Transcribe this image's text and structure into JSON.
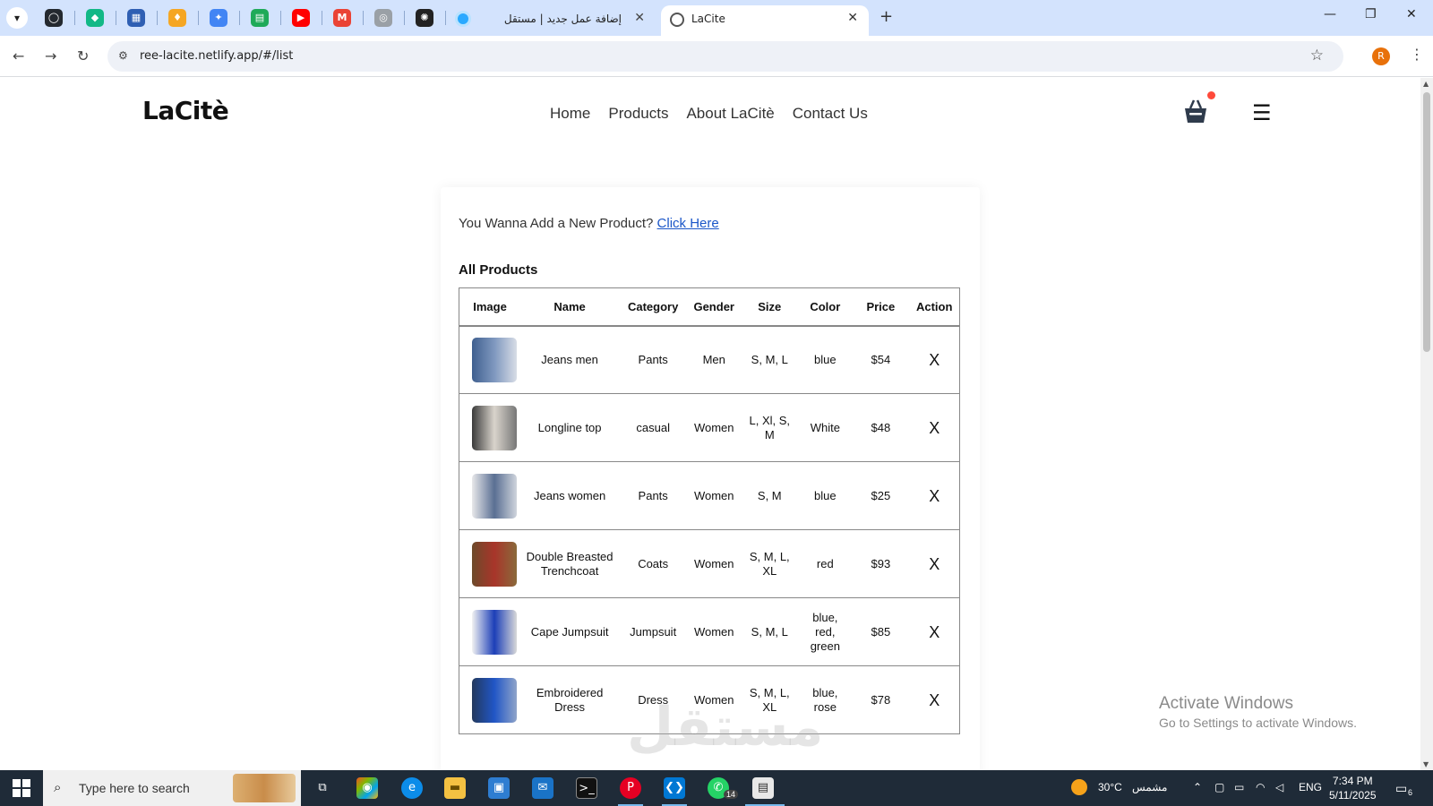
{
  "browser": {
    "pinned_tabs": [
      {
        "icon": "github-icon",
        "color": "#24292f",
        "glyph": "◯"
      },
      {
        "icon": "diamond-app-icon",
        "color": "#12b886",
        "glyph": "◆"
      },
      {
        "icon": "dashboard-app-icon",
        "color": "#2f5fb3",
        "glyph": "▦"
      },
      {
        "icon": "flame-app-icon",
        "color": "#f5a623",
        "glyph": "♦"
      },
      {
        "icon": "sparkle-app-icon",
        "color": "#4285f4",
        "glyph": "✦"
      },
      {
        "icon": "sheets-app-icon",
        "color": "#1faa59",
        "glyph": "▤"
      },
      {
        "icon": "youtube-icon",
        "color": "#ff0000",
        "glyph": "▶"
      },
      {
        "icon": "gmail-icon",
        "color": "#ea4335",
        "glyph": "M"
      },
      {
        "icon": "cat-app-icon",
        "color": "#9aa0a6",
        "glyph": "◎"
      },
      {
        "icon": "openai-icon",
        "color": "#222222",
        "glyph": "✺"
      }
    ],
    "inactive_tab_title": "إضافة عمل جديد | مستقل",
    "active_tab_title": "LaCite",
    "url": "ree-lacite.netlify.app/#/list",
    "profile_initial": "R"
  },
  "site": {
    "logo": "LaCitè",
    "nav": [
      "Home",
      "Products",
      "About LaCitè",
      "Contact Us"
    ],
    "intro_text": "You Wanna Add a New Product? ",
    "intro_link": "Click Here",
    "heading": "All Products",
    "columns": [
      "Image",
      "Name",
      "Category",
      "Gender",
      "Size",
      "Color",
      "Price",
      "Action"
    ],
    "products": [
      {
        "name": "Jeans men",
        "category": "Pants",
        "gender": "Men",
        "size": "S, M, L",
        "color": "blue",
        "price": "$54",
        "action": "X",
        "thumb": [
          "#3f5f8f",
          "#7f98bf",
          "#d8dde6"
        ]
      },
      {
        "name": "Longline top",
        "category": "casual",
        "gender": "Women",
        "size": "L, Xl, S, M",
        "color": "White",
        "price": "$48",
        "action": "X",
        "thumb": [
          "#3a3a3a",
          "#d9d4cc",
          "#777777"
        ]
      },
      {
        "name": "Jeans women",
        "category": "Pants",
        "gender": "Women",
        "size": "S, M",
        "color": "blue",
        "price": "$25",
        "action": "X",
        "thumb": [
          "#e8e8ea",
          "#5a6f93",
          "#cfd4dc"
        ]
      },
      {
        "name": "Double Breasted Trenchcoat",
        "category": "Coats",
        "gender": "Women",
        "size": "S, M, L, XL",
        "color": "red",
        "price": "$93",
        "action": "X",
        "thumb": [
          "#6d4a2a",
          "#a8352a",
          "#8a6a3b"
        ]
      },
      {
        "name": "Cape Jumpsuit",
        "category": "Jumpsuit",
        "gender": "Women",
        "size": "S, M, L",
        "color": "blue, red, green",
        "price": "$85",
        "action": "X",
        "thumb": [
          "#f2f2f2",
          "#1c3fb8",
          "#d8d8d8"
        ]
      },
      {
        "name": "Embroidered Dress",
        "category": "Dress",
        "gender": "Women",
        "size": "S, M, L, XL",
        "color": "blue, rose",
        "price": "$78",
        "action": "X",
        "thumb": [
          "#23395d",
          "#2156c6",
          "#8fa4c9"
        ]
      }
    ]
  },
  "windows": {
    "activate_title": "Activate Windows",
    "activate_sub": "Go to Settings to activate Windows.",
    "search_placeholder": "Type here to search",
    "temperature": "30°C",
    "weather_text": "مشمس",
    "language": "ENG",
    "time": "7:34 PM",
    "date": "5/11/2025",
    "whatsapp_badge": "14",
    "notifications": "6"
  },
  "watermark": "مستقل"
}
